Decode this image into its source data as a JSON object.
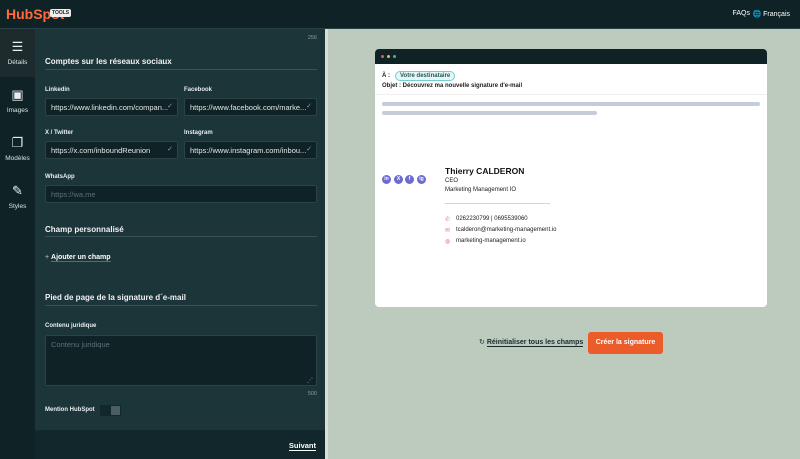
{
  "header": {
    "logo": "HubSpot",
    "logo_badge": "TOOLS",
    "faqs": "FAQs",
    "language": "Français"
  },
  "sidebar": {
    "items": [
      {
        "label": "Détails",
        "icon": "text-icon"
      },
      {
        "label": "Images",
        "icon": "image-icon"
      },
      {
        "label": "Modèles",
        "icon": "template-icon"
      },
      {
        "label": "Styles",
        "icon": "brush-icon"
      }
    ]
  },
  "form": {
    "char_count_top": "256",
    "social_title": "Comptes sur les réseaux sociaux",
    "linkedin": {
      "label": "Linkedin",
      "value": "https://www.linkedin.com/compan..."
    },
    "facebook": {
      "label": "Facebook",
      "value": "https://www.facebook.com/marke..."
    },
    "twitter": {
      "label": "X / Twitter",
      "value": "https://x.com/inboundReunion"
    },
    "instagram": {
      "label": "Instagram",
      "value": "https://www.instagram.com/inbou..."
    },
    "whatsapp": {
      "label": "WhatsApp",
      "placeholder": "https://wa.me"
    },
    "custom_title": "Champ personnalisé",
    "add_field": "Ajouter un champ",
    "footer_title": "Pied de page de la signature d´e-mail",
    "legal_label": "Contenu juridique",
    "legal_placeholder": "Contenu juridique",
    "legal_count": "500",
    "mention_label": "Mention HubSpot",
    "mention_on": false,
    "next": "Suivant"
  },
  "preview": {
    "to_label": "À :",
    "to_value": "Votre destinataire",
    "subject": "Objet : Découvrez ma nouvelle signature d'e-mail",
    "name": "Thierry CALDERON",
    "title": "CEO",
    "company": "Marketing Management IO",
    "phone": "0262230799 | 0695539060",
    "email": "tcalderon@marketing-management.io",
    "website": "marketing-management.io",
    "social_icons": [
      "in",
      "X",
      "f",
      "ig"
    ]
  },
  "actions": {
    "reset": "Réinitialiser tous les champs",
    "create": "Créer la signature"
  },
  "colors": {
    "accent": "#ec5b2a",
    "social": "#6b6bd1"
  }
}
